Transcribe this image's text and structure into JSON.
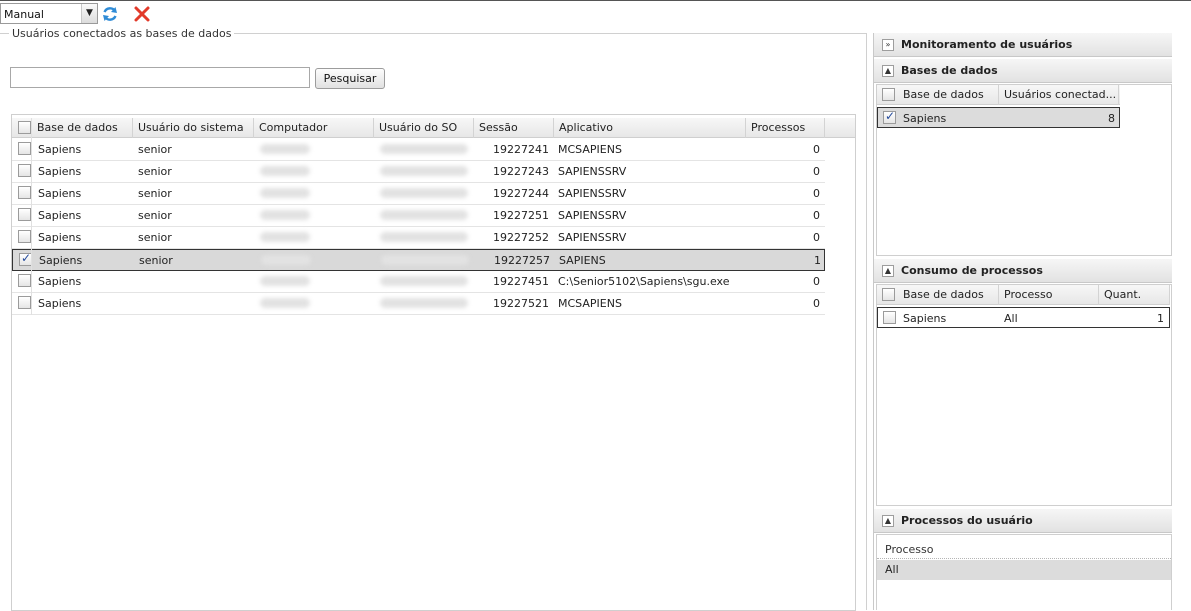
{
  "toolbar": {
    "mode_value": "Manual",
    "refresh_label": "",
    "close_label": ""
  },
  "connected": {
    "legend": "Usuários conectados as bases de dados",
    "search_value": "",
    "search_button": "Pesquisar",
    "columns": [
      "Base de dados",
      "Usuário do sistema",
      "Computador",
      "Usuário do SO",
      "Sessão",
      "Aplicativo",
      "Processos"
    ],
    "rows": [
      {
        "base": "Sapiens",
        "user": "senior",
        "sessao": "19227241",
        "app": "MCSAPIENS",
        "proc": "0",
        "checked": false
      },
      {
        "base": "Sapiens",
        "user": "senior",
        "sessao": "19227243",
        "app": "SAPIENSSRV",
        "proc": "0",
        "checked": false
      },
      {
        "base": "Sapiens",
        "user": "senior",
        "sessao": "19227244",
        "app": "SAPIENSSRV",
        "proc": "0",
        "checked": false
      },
      {
        "base": "Sapiens",
        "user": "senior",
        "sessao": "19227251",
        "app": "SAPIENSSRV",
        "proc": "0",
        "checked": false
      },
      {
        "base": "Sapiens",
        "user": "senior",
        "sessao": "19227252",
        "app": "SAPIENSSRV",
        "proc": "0",
        "checked": false
      },
      {
        "base": "Sapiens",
        "user": "senior",
        "sessao": "19227257",
        "app": "SAPIENS",
        "proc": "1",
        "checked": true
      },
      {
        "base": "Sapiens",
        "user": "",
        "sessao": "19227451",
        "app": "C:\\Senior5102\\Sapiens\\sgu.exe",
        "proc": "0",
        "checked": false
      },
      {
        "base": "Sapiens",
        "user": "",
        "sessao": "19227521",
        "app": "MCSAPIENS",
        "proc": "0",
        "checked": false
      }
    ]
  },
  "monitor": {
    "title": "Monitoramento de usuários",
    "bases": {
      "title": "Bases de dados",
      "columns": [
        "Base de dados",
        "Usuários conectad..."
      ],
      "row": {
        "base": "Sapiens",
        "count": "8",
        "checked": true
      }
    },
    "consumo": {
      "title": "Consumo de processos",
      "columns": [
        "Base de dados",
        "Processo",
        "Quant."
      ],
      "row": {
        "base": "Sapiens",
        "processo": "All",
        "quant": "1",
        "checked": false
      }
    },
    "processos": {
      "title": "Processos do usuário",
      "column": "Processo",
      "row": "All"
    }
  }
}
